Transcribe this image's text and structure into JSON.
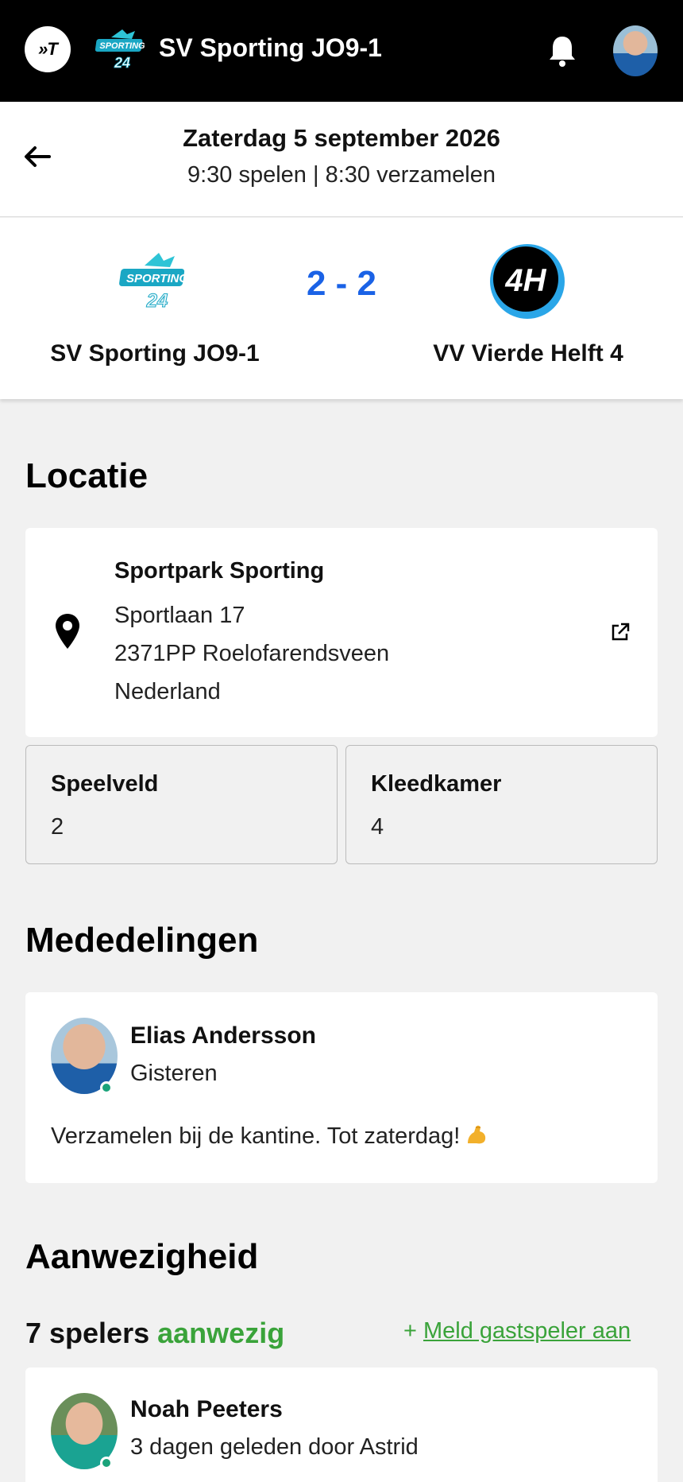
{
  "header": {
    "app_logo_text": "»T",
    "team_title": "SV Sporting JO9-1",
    "icons": [
      "app-logo-icon",
      "sporting-logo-icon",
      "bell-icon",
      "user-avatar"
    ]
  },
  "match": {
    "date": "Zaterdag 5 september 2026",
    "times": "9:30 spelen | 8:30 verzamelen",
    "home_team": "SV Sporting JO9-1",
    "away_team": "VV Vierde Helft 4",
    "score": "2 - 2",
    "home_logo_text": "SPORTING",
    "home_logo_number": "24",
    "away_logo_text": "4H",
    "score_color": "#1a62e6"
  },
  "location": {
    "title": "Locatie",
    "name": "Sportpark Sporting",
    "street": "Sportlaan 17",
    "city": "2371PP Roelofarendsveen",
    "country": "Nederland",
    "field_label": "Speelveld",
    "field_value": "2",
    "dressing_label": "Kleedkamer",
    "dressing_value": "4"
  },
  "announcements": {
    "title": "Mededelingen",
    "author": "Elias Andersson",
    "time": "Gisteren",
    "text": "Verzamelen bij de kantine. Tot zaterdag!"
  },
  "presence": {
    "title": "Aanwezigheid",
    "count": "7 spelers",
    "status": "aanwezig",
    "guest_plus": "+",
    "guest_link": "Meld gastspeler aan",
    "accent": "#3aa33a",
    "players": [
      {
        "name": "Noah Peeters",
        "subtitle": "3 dagen geleden door Astrid"
      }
    ]
  }
}
